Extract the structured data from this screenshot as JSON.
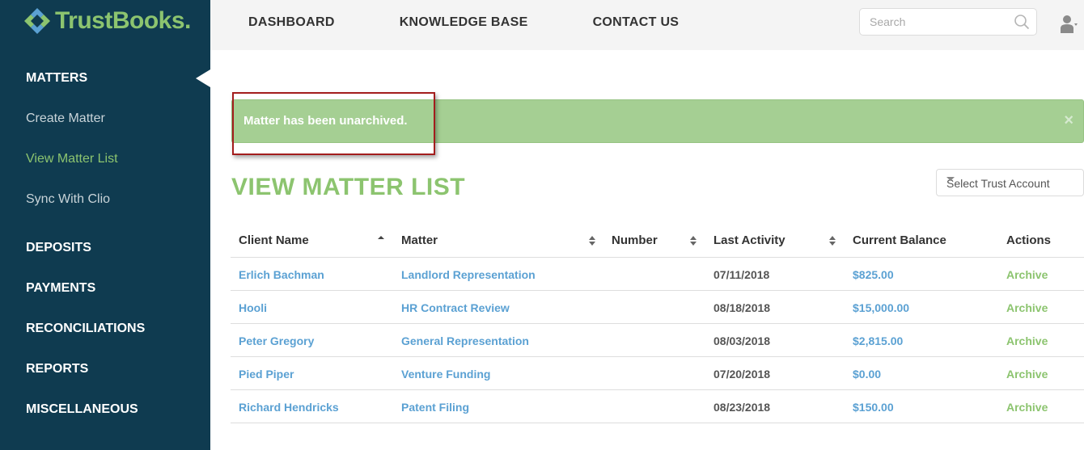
{
  "brand": {
    "name": "TrustBooks",
    "suffix": "."
  },
  "sidebar": {
    "items": [
      {
        "label": "MATTERS",
        "type": "section",
        "active": true
      },
      {
        "label": "Create Matter",
        "type": "sub"
      },
      {
        "label": "View Matter List",
        "type": "sub",
        "active": true
      },
      {
        "label": "Sync With Clio",
        "type": "sub"
      },
      {
        "label": "DEPOSITS",
        "type": "section"
      },
      {
        "label": "PAYMENTS",
        "type": "section"
      },
      {
        "label": "RECONCILIATIONS",
        "type": "section"
      },
      {
        "label": "REPORTS",
        "type": "section"
      },
      {
        "label": "MISCELLANEOUS",
        "type": "section"
      }
    ]
  },
  "topnav": {
    "dashboard": "DASHBOARD",
    "knowledge_base": "KNOWLEDGE BASE",
    "contact_us": "CONTACT US"
  },
  "search": {
    "placeholder": "Search"
  },
  "alert": {
    "message": "Matter has been unarchived.",
    "close": "×"
  },
  "page": {
    "title": "VIEW MATTER LIST",
    "trust_select": "Select Trust Account"
  },
  "table": {
    "headers": {
      "client": "Client Name",
      "matter": "Matter",
      "number": "Number",
      "activity": "Last Activity",
      "balance": "Current Balance",
      "actions": "Actions"
    },
    "rows": [
      {
        "client": "Erlich Bachman",
        "matter": "Landlord Representation",
        "number": "",
        "activity": "07/11/2018",
        "balance": "$825.00",
        "action": "Archive"
      },
      {
        "client": "Hooli",
        "matter": "HR Contract Review",
        "number": "",
        "activity": "08/18/2018",
        "balance": "$15,000.00",
        "action": "Archive"
      },
      {
        "client": "Peter Gregory",
        "matter": "General Representation",
        "number": "",
        "activity": "08/03/2018",
        "balance": "$2,815.00",
        "action": "Archive"
      },
      {
        "client": "Pied Piper",
        "matter": "Venture Funding",
        "number": "",
        "activity": "07/20/2018",
        "balance": "$0.00",
        "action": "Archive"
      },
      {
        "client": "Richard Hendricks",
        "matter": "Patent Filing",
        "number": "",
        "activity": "08/23/2018",
        "balance": "$150.00",
        "action": "Archive"
      }
    ]
  },
  "colors": {
    "sidebar_bg": "#0f3b50",
    "brand_green": "#8cc46f",
    "link_blue": "#5ba1d3",
    "alert_bg": "#a5cf93",
    "highlight_red": "#a31d1d"
  }
}
